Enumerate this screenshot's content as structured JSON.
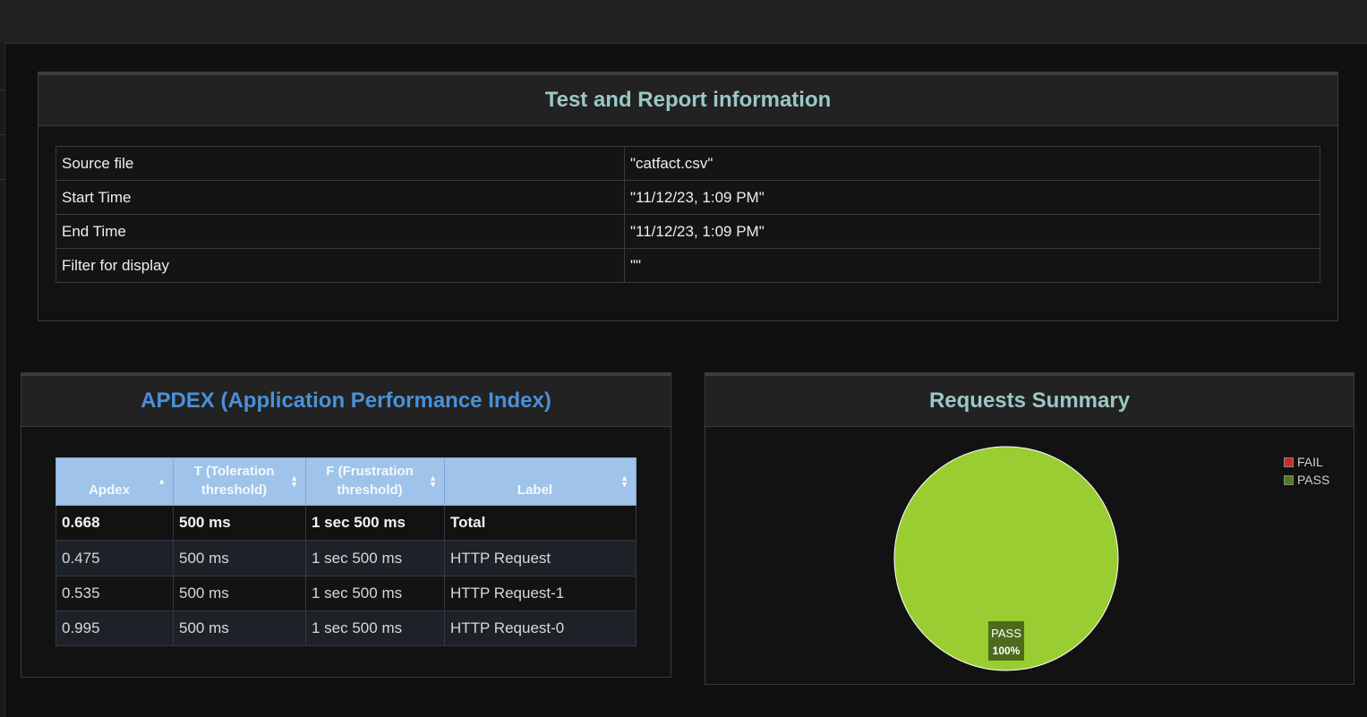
{
  "info": {
    "title": "Test and Report information",
    "rows": [
      {
        "key": "Source file",
        "value": "\"catfact.csv\""
      },
      {
        "key": "Start Time",
        "value": "\"11/12/23, 1:09 PM\""
      },
      {
        "key": "End Time",
        "value": "\"11/12/23, 1:09 PM\""
      },
      {
        "key": "Filter for display",
        "value": "\"\""
      }
    ]
  },
  "apdex": {
    "title": "APDEX (Application Performance Index)",
    "headers": [
      "Apdex",
      "T (Toleration threshold)",
      "F (Frustration threshold)",
      "Label"
    ],
    "rows": [
      [
        "0.668",
        "500 ms",
        "1 sec 500 ms",
        "Total"
      ],
      [
        "0.475",
        "500 ms",
        "1 sec 500 ms",
        "HTTP Request"
      ],
      [
        "0.535",
        "500 ms",
        "1 sec 500 ms",
        "HTTP Request-1"
      ],
      [
        "0.995",
        "500 ms",
        "1 sec 500 ms",
        "HTTP Request-0"
      ]
    ]
  },
  "summary": {
    "title": "Requests Summary",
    "legend": [
      {
        "label": "FAIL",
        "color": "#cb2b2b"
      },
      {
        "label": "PASS",
        "color": "#4c7d1f"
      }
    ],
    "pie_label": {
      "name": "PASS",
      "percent": "100%"
    }
  },
  "chart_data": {
    "type": "pie",
    "title": "Requests Summary",
    "slices": [
      {
        "label": "FAIL",
        "value": 0,
        "color": "#cb2b2b"
      },
      {
        "label": "PASS",
        "value": 100,
        "color": "#9acd32"
      }
    ],
    "legend_position": "top-right"
  }
}
